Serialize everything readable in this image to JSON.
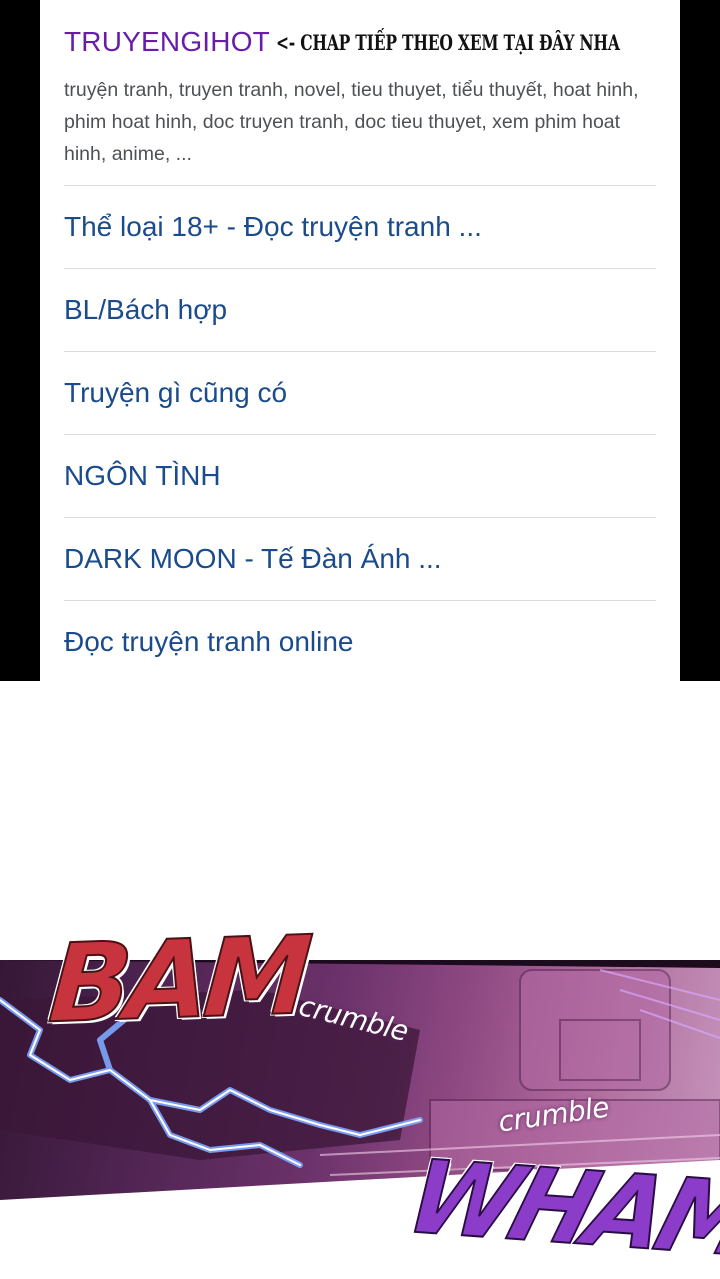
{
  "result": {
    "site_title": "TRUYENGIHOT",
    "promo_text": "<- CHAP TIẾP THEO XEM TẠI ĐÂY NHA",
    "snippet": "truyện tranh, truyen tranh, novel, tieu thuyet, tiểu thuyết, hoat hinh, phim hoat hinh, doc truyen tranh, doc tieu thuyet, xem phim hoat hinh, anime, ...",
    "sitelinks": [
      {
        "label": "Thể loại 18+ - Đọc truyện tranh ..."
      },
      {
        "label": "BL/Bách hợp"
      },
      {
        "label": "Truyện gì cũng có"
      },
      {
        "label": "NGÔN TÌNH"
      },
      {
        "label": "DARK MOON - Tế Đàn Ánh ..."
      },
      {
        "label": "Đọc truyện tranh online"
      }
    ],
    "colors": {
      "title": "#681da8",
      "link": "#1a4b8c",
      "snippet": "#4d5156",
      "divider": "#dadce0"
    }
  },
  "comic": {
    "sfx_1": "BAM",
    "sfx_2": "crumble",
    "sfx_3": "crumble",
    "sfx_4": "WHAM",
    "colors": {
      "bam": "#c8343e",
      "wham": "#8b3cc8",
      "lightning": "#7fa8ff"
    }
  }
}
